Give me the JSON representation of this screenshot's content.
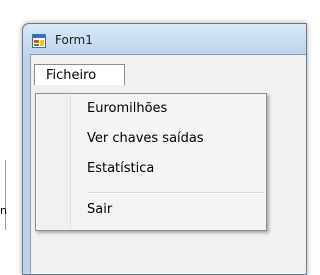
{
  "window": {
    "title": "Form1",
    "icon": "form-window-icon"
  },
  "menubar": {
    "items": [
      {
        "label": "Ficheiro",
        "state": "open"
      }
    ]
  },
  "dropdown": {
    "items": [
      {
        "label": "Euromilhões"
      },
      {
        "label": "Ver chaves saídas"
      },
      {
        "label": "Estatística"
      },
      {
        "separator": true
      },
      {
        "label": "Sair"
      }
    ]
  },
  "background": {
    "fragment_text": "n"
  },
  "colors": {
    "titlebar_top": "#d9e8f6",
    "titlebar_bottom": "#bed5ec",
    "menu_background": "#f4f4f4",
    "client_background": "#f0f0f0"
  }
}
